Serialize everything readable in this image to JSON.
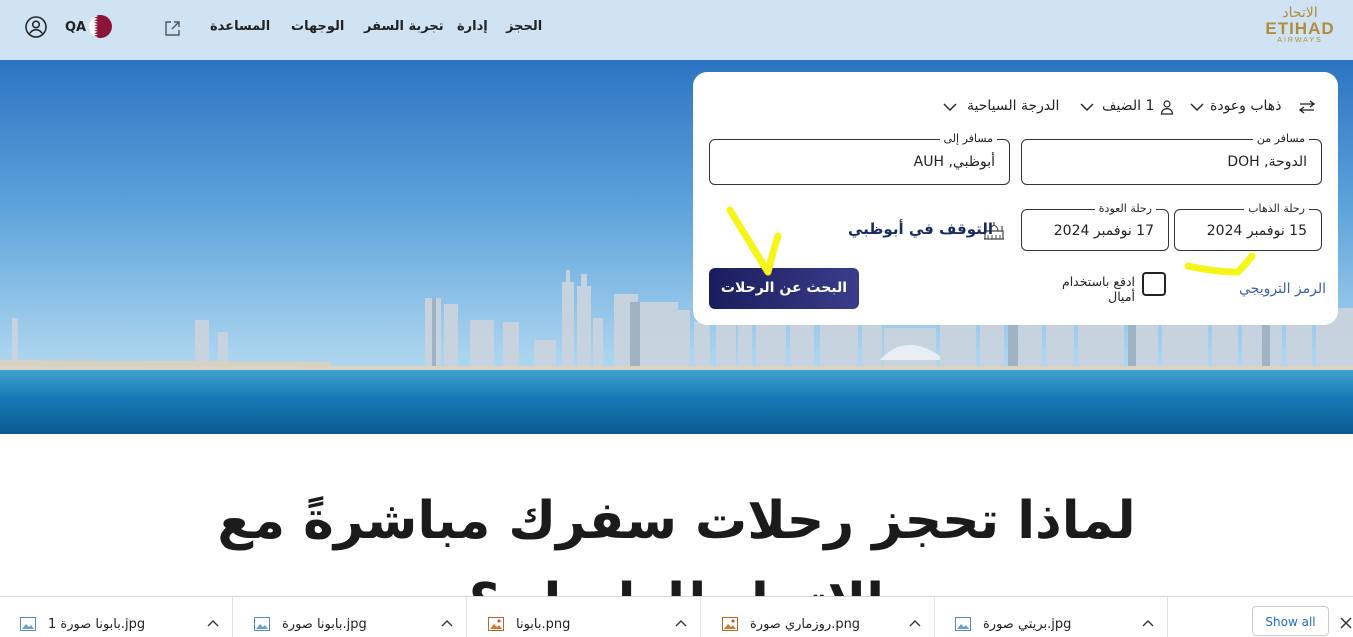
{
  "header": {
    "country_code": "QA",
    "nav": [
      "الحجز",
      "إدارة",
      "تجربة السفر",
      "الوجهات",
      "المساعدة"
    ],
    "logo": {
      "arabic": "الاتحاد",
      "english": "ETIHAD",
      "sub": "AIRWAYS",
      "color": "#b08d3c"
    }
  },
  "booking": {
    "trip_type": "ذهاب وعودة",
    "passengers": "1 الضيف",
    "cabin_class": "الدرجة السياحية",
    "from": {
      "label": "مسافر من",
      "value": "الدوحة, DOH"
    },
    "to": {
      "label": "مسافر إلى",
      "value": "أبوظبي, AUH"
    },
    "depart": {
      "label": "رحلة الذهاب",
      "value": "15 نوفمبر 2024"
    },
    "return": {
      "label": "رحلة العودة",
      "value": "17 نوفمبر 2024"
    },
    "stopover": "التوقف في أبوظبي",
    "promo_code": "الرمز الترويجي",
    "pay_with_miles": "ادفع باستخدام أميال",
    "search_button": "البحث عن الرحلات",
    "button_color": "#1a1d5c"
  },
  "headline": {
    "line1": "لماذا تحجز رحلات سفرك مباشرةً مع",
    "line2": "الاتحاد للطيران؟"
  },
  "downloads": {
    "items": [
      {
        "name": "بابونا صورة 1.jpg",
        "icon": "image-file-icon"
      },
      {
        "name": "بابونا صورة.jpg",
        "icon": "image-file-icon"
      },
      {
        "name": "بابونا.png",
        "icon": "png-file-icon"
      },
      {
        "name": "روزماري صورة.png",
        "icon": "png-file-icon"
      },
      {
        "name": "بريتي صورة.jpg",
        "icon": "image-file-icon"
      }
    ],
    "show_all": "Show all"
  }
}
